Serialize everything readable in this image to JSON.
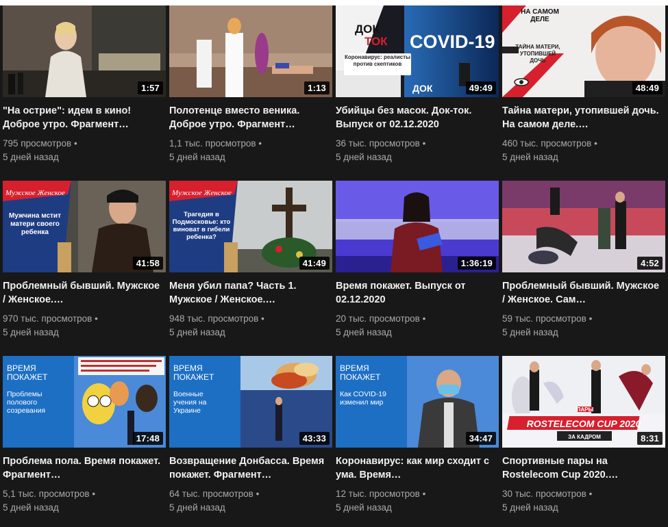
{
  "videos": [
    {
      "title": "\"На острие\": идем в кино! Доброе утро. Фрагмент…",
      "views": "795 просмотров •",
      "age": "5 дней назад",
      "duration": "1:57"
    },
    {
      "title": "Полотенце вместо веника. Доброе утро. Фрагмент…",
      "views": "1,1 тыс. просмотров •",
      "age": "5 дней назад",
      "duration": "1:13"
    },
    {
      "title": "Убийцы без масок. Док-ток. Выпуск от 02.12.2020",
      "views": "36 тыс. просмотров •",
      "age": "5 дней назад",
      "duration": "49:49",
      "overlay": {
        "brand_top": "ДОК",
        "brand_bottom": "ТОК",
        "headline": "COVID-19",
        "caption": "Коронавирус: реалисты против скептиков"
      }
    },
    {
      "title": "Тайна матери, утопившей дочь. На самом деле.…",
      "views": "460 тыс. просмотров •",
      "age": "5 дней назад",
      "duration": "48:49",
      "overlay": {
        "brand": "НА САМОМ ДЕЛЕ",
        "caption": "ТАЙНА МАТЕРИ, УТОПИВШЕЙ ДОЧЬ"
      }
    },
    {
      "title": "Проблемный бывший. Мужское / Женское.…",
      "views": "970 тыс. просмотров •",
      "age": "5 дней назад",
      "duration": "41:58",
      "overlay": {
        "brand": "Мужское Женское",
        "caption": "Мужчина мстит матери своего ребенка"
      }
    },
    {
      "title": "Меня убил папа? Часть 1. Мужское / Женское.…",
      "views": "948 тыс. просмотров •",
      "age": "5 дней назад",
      "duration": "41:49",
      "overlay": {
        "brand": "Мужское Женское",
        "caption": "Трагедия в Подмосковье: кто виноват в гибели ребенка?"
      }
    },
    {
      "title": "Время покажет. Выпуск от 02.12.2020",
      "views": "20 тыс. просмотров •",
      "age": "5 дней назад",
      "duration": "1:36:19"
    },
    {
      "title": "Проблемный бывший. Мужское / Женское. Сам…",
      "views": "59 тыс. просмотров •",
      "age": "5 дней назад",
      "duration": "4:52"
    },
    {
      "title": "Проблема пола. Время покажет. Фрагмент…",
      "views": "5,1 тыс. просмотров •",
      "age": "5 дней назад",
      "duration": "17:48",
      "overlay": {
        "brand": "ВРЕМЯ ПОКАЖЕТ",
        "caption": "Проблемы полового созревания"
      }
    },
    {
      "title": "Возвращение Донбасса. Время покажет. Фрагмент…",
      "views": "64 тыс. просмотров •",
      "age": "5 дней назад",
      "duration": "43:33",
      "overlay": {
        "brand": "ВРЕМЯ ПОКАЖЕТ",
        "caption": "Военные учения на Украине"
      }
    },
    {
      "title": "Коронавирус: как мир сходит с ума. Время…",
      "views": "12 тыс. просмотров •",
      "age": "5 дней назад",
      "duration": "34:47",
      "overlay": {
        "brand": "ВРЕМЯ ПОКАЖЕТ",
        "caption": "Как COVID-19 изменил мир"
      }
    },
    {
      "title": "Спортивные пары на Rostelecom Cup 2020.…",
      "views": "30 тыс. просмотров •",
      "age": "5 дней назад",
      "duration": "8:31",
      "overlay": {
        "brand": "ПАРЫ",
        "headline": "ROSTELECOM CUP 2020",
        "caption": "ЗА КАДРОМ"
      }
    }
  ],
  "colors": {
    "background": "#181818",
    "title": "#f1f1f1",
    "meta": "#aaaaaa",
    "accent_red": "#d6202e",
    "vp_blue": "#1d6fc4"
  }
}
